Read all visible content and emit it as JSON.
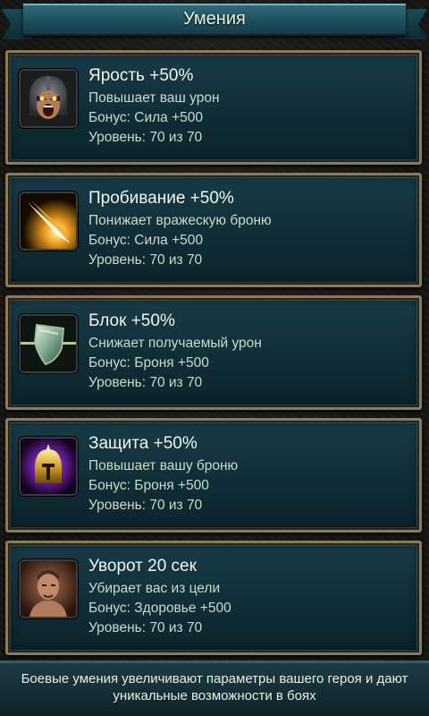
{
  "header": {
    "title": "Умения"
  },
  "skills": [
    {
      "name": "Ярость +50%",
      "description": "Повышает ваш урон",
      "bonus": "Бонус: Сила +500",
      "level": "Уровень: 70 из 70",
      "icon": "rage-helmet-icon"
    },
    {
      "name": "Пробивание +50%",
      "description": "Понижает вражескую броню",
      "bonus": "Бонус: Сила +500",
      "level": "Уровень: 70 из 70",
      "icon": "pierce-spear-icon"
    },
    {
      "name": "Блок +50%",
      "description": "Снижает получаемый урон",
      "bonus": "Бонус: Броня +500",
      "level": "Уровень: 70 из 70",
      "icon": "shield-icon"
    },
    {
      "name": "Защита +50%",
      "description": "Повышает вашу броню",
      "bonus": "Бонус: Броня +500",
      "level": "Уровень: 70 из 70",
      "icon": "golden-helmet-icon"
    },
    {
      "name": "Уворот 20 сек",
      "description": "Убирает вас из цели",
      "bonus": "Бонус: Здоровье +500",
      "level": "Уровень: 70 из 70",
      "icon": "hero-portrait-icon"
    }
  ],
  "footer": {
    "message": "Боевые умения увеличивают параметры вашего героя и дают уникальные возможности в боях"
  }
}
